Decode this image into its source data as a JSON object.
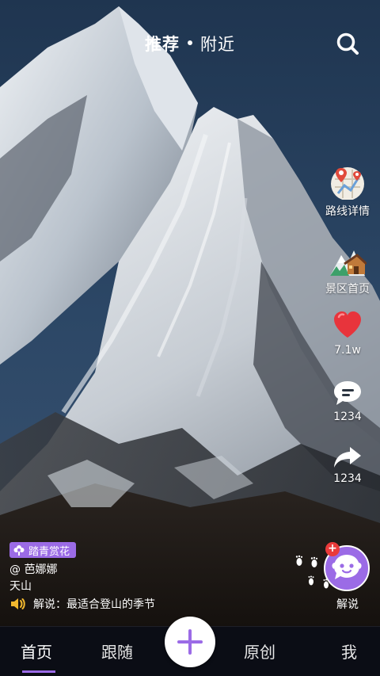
{
  "header": {
    "tab_recommend": "推荐",
    "tab_nearby": "附近"
  },
  "rail": {
    "route_label": "路线详情",
    "scenic_label": "景区首页",
    "like_count": "7.1w",
    "comment_count": "1234",
    "share_count": "1234"
  },
  "post": {
    "tag_label": "踏青赏花",
    "author": "@ 芭娜娜",
    "place": "天山",
    "narration": "解说：最适合登山的季节"
  },
  "narrator": {
    "plus": "+",
    "label": "解说"
  },
  "bottom_nav": {
    "home": "首页",
    "follow": "跟随",
    "original": "原创",
    "me": "我"
  },
  "colors": {
    "accent": "#9b6be6",
    "like": "#e8343c",
    "badge": "#ea3a3a"
  }
}
